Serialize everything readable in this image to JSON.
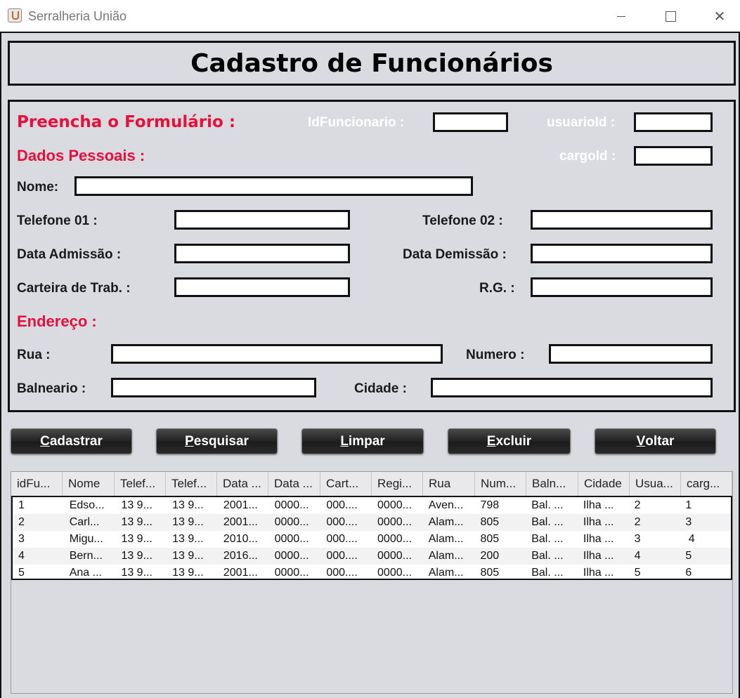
{
  "window": {
    "title": "Serralheria União",
    "icon": "java-cup-icon",
    "close_glyph": "✕"
  },
  "header": {
    "title": "Cadastro de Funcionários"
  },
  "form": {
    "section_title": "Preencha o Formulário :",
    "personal_title": "Dados Pessoais :",
    "address_title": "Endereço :",
    "id_funcionario_label": "IdFuncionario :",
    "usuario_id_label": "usuarioId :",
    "cargo_id_label": "cargoId :",
    "nome_label": "Nome:",
    "telefone1_label": "Telefone 01 :",
    "telefone2_label": "Telefone  02 :",
    "data_admissao_label": "Data Admissão :",
    "data_demissao_label": "Data Demissão :",
    "carteira_label": "Carteira de Trab. :",
    "rg_label": "R.G. :",
    "rua_label": "Rua :",
    "numero_label": "Numero :",
    "balneario_label": "Balneario :",
    "cidade_label": "Cidade :",
    "values": {
      "id_funcionario": "",
      "usuario_id": "",
      "cargo_id": "",
      "nome": "",
      "telefone1": "",
      "telefone2": "",
      "data_admissao": "",
      "data_demissao": "",
      "carteira": "",
      "rg": "",
      "rua": "",
      "numero": "",
      "balneario": "",
      "cidade": ""
    }
  },
  "buttons": {
    "cadastrar": {
      "mnemonic": "C",
      "rest": "adastrar"
    },
    "pesquisar": {
      "mnemonic": "P",
      "rest": "esquisar"
    },
    "limpar": {
      "mnemonic": "L",
      "rest": "impar"
    },
    "excluir": {
      "mnemonic": "E",
      "rest": "xcluir"
    },
    "voltar": {
      "mnemonic": "V",
      "rest": "oltar"
    }
  },
  "table": {
    "columns": [
      "idFu...",
      "Nome",
      "Telef...",
      "Telef...",
      "Data ...",
      "Data ...",
      "Cart...",
      "Regi...",
      "Rua",
      "Num...",
      "Baln...",
      "Cidade",
      "Usua...",
      "carg..."
    ],
    "rows": [
      [
        "1",
        "Edso...",
        "13 9...",
        "13 9...",
        "2001...",
        "0000...",
        "000....",
        "0000...",
        "Aven...",
        "798",
        "Bal. ...",
        "Ilha ...",
        "2",
        "1"
      ],
      [
        "2",
        "Carl...",
        "13 9...",
        "13 9...",
        "2001...",
        "0000...",
        "000....",
        "0000...",
        "Alam...",
        "805",
        "Bal. ...",
        "Ilha ...",
        "2",
        "3"
      ],
      [
        "3",
        "Migu...",
        "13 9...",
        "13 9...",
        "2010...",
        "0000...",
        "000....",
        "0000...",
        "Alam...",
        "805",
        "Bal. ...",
        "Ilha ...",
        "3",
        " 4"
      ],
      [
        "4",
        "Bern...",
        "13 9...",
        "13 9...",
        "2016...",
        "0000...",
        "000....",
        "0000...",
        "Alam...",
        "200",
        "Bal. ...",
        "Ilha ...",
        "4",
        "5"
      ],
      [
        "5",
        "Ana ...",
        "13 9...",
        "13 9...",
        "2001...",
        "0000...",
        "000....",
        "0000...",
        "Alam...",
        "805",
        "Bal. ...",
        "Ilha ...",
        "5",
        "6"
      ]
    ]
  },
  "colors": {
    "accent_red": "#e8103a",
    "panel_bg": "#d9dbe1",
    "button_bg": "#1c1c1c"
  }
}
